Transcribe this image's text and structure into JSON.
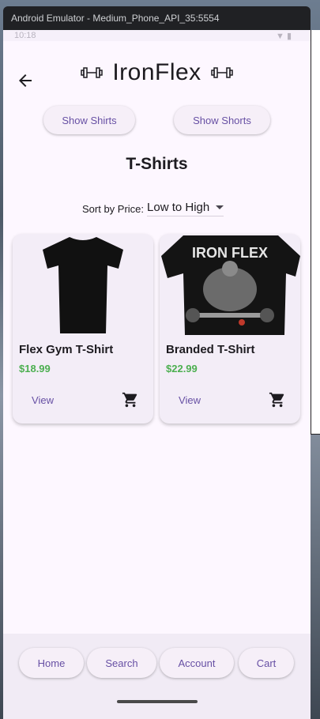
{
  "window": {
    "title": "Android Emulator - Medium_Phone_API_35:5554"
  },
  "status_bar": {
    "time": "10:18",
    "icons": "▼ ▮"
  },
  "app": {
    "title": "IronFlex",
    "back_label": "Back"
  },
  "filters": {
    "show_shirts": "Show Shirts",
    "show_shorts": "Show Shorts"
  },
  "section": {
    "title": "T-Shirts"
  },
  "sort": {
    "label": "Sort by Price:",
    "value": "Low to High"
  },
  "products": [
    {
      "name": "Flex Gym T-Shirt",
      "price": "$18.99",
      "view_label": "View",
      "image": "black-tshirt"
    },
    {
      "name": "Branded T-Shirt",
      "price": "$22.99",
      "view_label": "View",
      "image": "ironflex-graphic-tshirt",
      "image_text": "IRON FLEX"
    }
  ],
  "bottom_nav": {
    "home": "Home",
    "search": "Search",
    "account": "Account",
    "cart": "Cart"
  },
  "colors": {
    "accent": "#6750a4",
    "price": "#4caf50",
    "background": "#fdf7ff",
    "card": "#f3edf7"
  }
}
